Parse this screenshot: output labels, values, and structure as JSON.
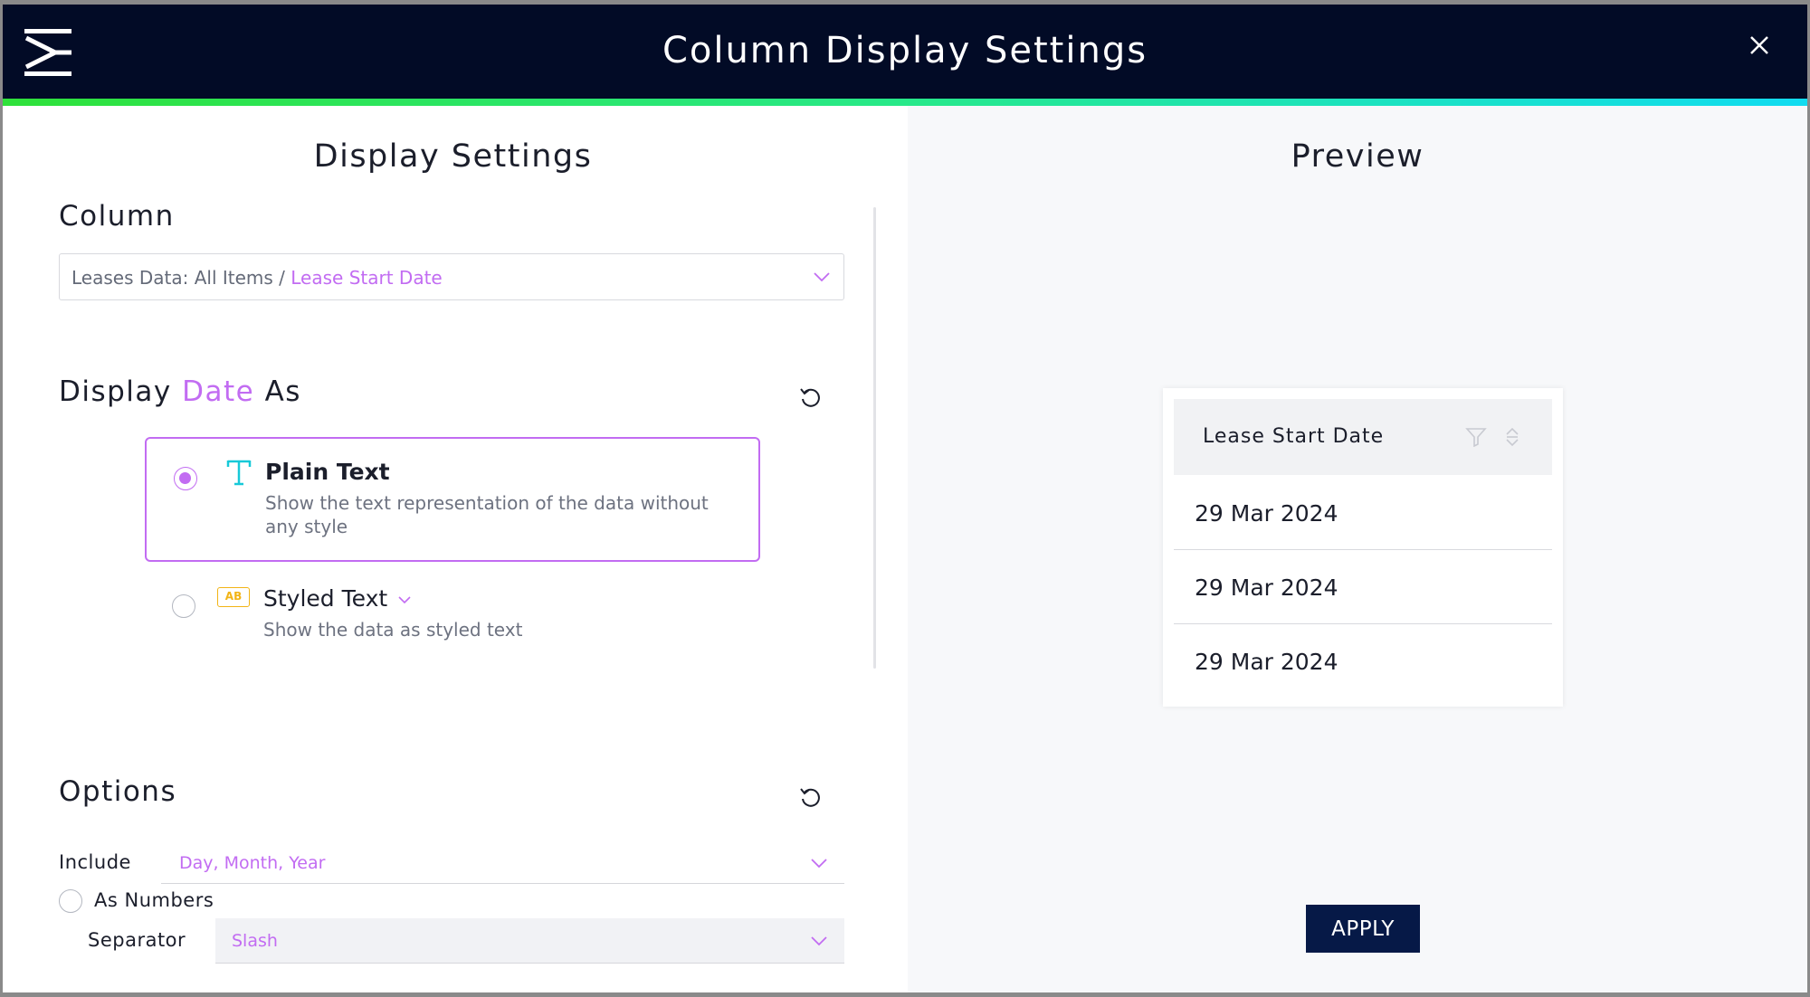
{
  "window": {
    "title": "Column Display Settings",
    "logo_icon": "app-logo-icon",
    "close_icon": "close-icon"
  },
  "left_panel": {
    "heading": "Display Settings",
    "column": {
      "title": "Column",
      "select_prefix": "Leases Data: All Items / ",
      "select_value": "Lease Start Date"
    },
    "display_as": {
      "title_before": "Display ",
      "title_accent": "Date",
      "title_after": " As",
      "options": [
        {
          "title": "Plain Text",
          "description_line1": "Show the text representation of the data without",
          "description_line2": "any style",
          "selected": true,
          "icon": "text-t-icon"
        },
        {
          "title": "Styled Text",
          "description": "Show the data as styled text",
          "selected": false,
          "icon": "ab-badge-icon",
          "badge_text": "AB"
        }
      ]
    },
    "options": {
      "title": "Options",
      "include_label": "Include",
      "include_value": "Day, Month, Year",
      "as_numbers_label": "As Numbers",
      "separator_label": "Separator",
      "separator_value": "Slash"
    }
  },
  "right_panel": {
    "heading": "Preview",
    "column_header": "Lease Start Date",
    "rows": [
      "29 Mar 2024",
      "29 Mar 2024",
      "29 Mar 2024"
    ],
    "apply_label": "APPLY"
  },
  "colors": {
    "accent": "#c26cf2",
    "header_bg": "#020b26",
    "apply_bg": "#061947",
    "gradient": [
      "#2fe13a",
      "#11dcf1"
    ]
  }
}
